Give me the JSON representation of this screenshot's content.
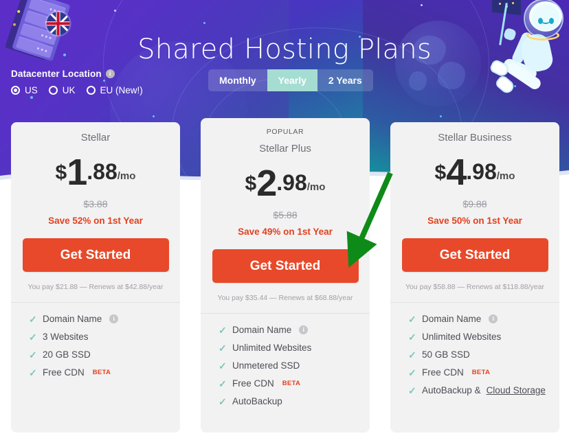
{
  "hero": {
    "title": "Shared Hosting Plans",
    "datacenter": {
      "label": "Datacenter Location",
      "info_icon": "info-icon",
      "options": [
        {
          "label": "US",
          "selected": true
        },
        {
          "label": "UK",
          "selected": false
        },
        {
          "label": "EU (New!)",
          "selected": false
        }
      ]
    },
    "billing": {
      "options": [
        {
          "label": "Monthly",
          "active": false
        },
        {
          "label": "Yearly",
          "active": true
        },
        {
          "label": "2 Years",
          "active": false
        }
      ]
    },
    "illustrations": {
      "left": "server-rack-uk-flag-illustration",
      "right": "yeti-astronaut-mascot-illustration"
    },
    "colors": {
      "gradient_start": "#5b2ec4",
      "gradient_end": "#0fa9a0",
      "toggle_active_bg": "#a5ddd2"
    }
  },
  "plans": [
    {
      "badge": "",
      "name": "Stellar",
      "currency": "$",
      "whole": "1",
      "cents": ".88",
      "period": "/mo",
      "old_price": "$3.88",
      "save": "Save 52% on 1st Year",
      "cta": "Get Started",
      "renew": "You pay $21.88 — Renews at $42.88/year",
      "features": [
        {
          "text": "Domain Name",
          "info": true,
          "beta": false,
          "link": ""
        },
        {
          "text": "3 Websites",
          "info": false,
          "beta": false,
          "link": ""
        },
        {
          "text": "20 GB SSD",
          "info": false,
          "beta": false,
          "link": ""
        },
        {
          "text": "Free CDN",
          "info": false,
          "beta": true,
          "beta_label": "BETA",
          "link": ""
        }
      ]
    },
    {
      "badge": "POPULAR",
      "name": "Stellar Plus",
      "currency": "$",
      "whole": "2",
      "cents": ".98",
      "period": "/mo",
      "old_price": "$5.88",
      "save": "Save 49% on 1st Year",
      "cta": "Get Started",
      "renew": "You pay $35.44 — Renews at $68.88/year",
      "features": [
        {
          "text": "Domain Name",
          "info": true,
          "beta": false,
          "link": ""
        },
        {
          "text": "Unlimited Websites",
          "info": false,
          "beta": false,
          "link": ""
        },
        {
          "text": "Unmetered SSD",
          "info": false,
          "beta": false,
          "link": ""
        },
        {
          "text": "Free CDN",
          "info": false,
          "beta": true,
          "beta_label": "BETA",
          "link": ""
        },
        {
          "text": "AutoBackup",
          "info": false,
          "beta": false,
          "link": ""
        }
      ]
    },
    {
      "badge": "",
      "name": "Stellar Business",
      "currency": "$",
      "whole": "4",
      "cents": ".98",
      "period": "/mo",
      "old_price": "$9.88",
      "save": "Save 50% on 1st Year",
      "cta": "Get Started",
      "renew": "You pay $58.88 — Renews at $118.88/year",
      "features": [
        {
          "text": "Domain Name",
          "info": true,
          "beta": false,
          "link": ""
        },
        {
          "text": "Unlimited Websites",
          "info": false,
          "beta": false,
          "link": ""
        },
        {
          "text": "50 GB SSD",
          "info": false,
          "beta": false,
          "link": ""
        },
        {
          "text": "Free CDN",
          "info": false,
          "beta": true,
          "beta_label": "BETA",
          "link": ""
        },
        {
          "text": "AutoBackup & ",
          "info": false,
          "beta": false,
          "link": "Cloud Storage"
        }
      ]
    }
  ],
  "annotation": {
    "type": "arrow",
    "color": "#0e8a18",
    "points_to": "stellar-plus-get-started-button"
  },
  "theme": {
    "cta_color": "#e8492a",
    "save_color": "#e3401f",
    "card_bg": "#f2f2f2",
    "check_color": "#7cc6bc"
  }
}
